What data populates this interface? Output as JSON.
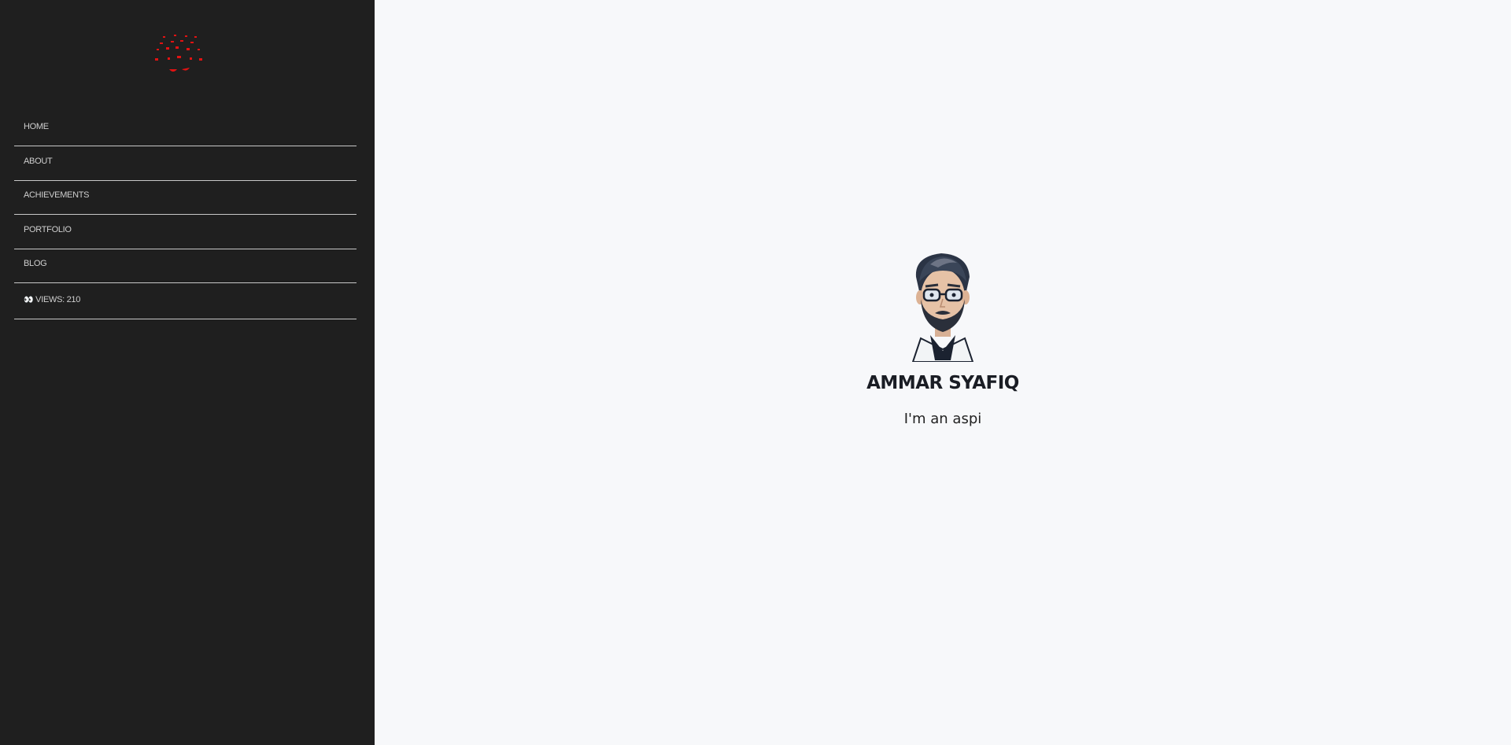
{
  "sidebar": {
    "logo_icon": "red-glyph-logo-icon",
    "accent_color": "#e21212",
    "nav": [
      {
        "label": "HOME"
      },
      {
        "label": "ABOUT"
      },
      {
        "label": "ACHIEVEMENTS"
      },
      {
        "label": "PORTFOLIO"
      },
      {
        "label": "BLOG"
      }
    ],
    "views": {
      "icon": "👀",
      "label": "VIEWS: 210"
    }
  },
  "main": {
    "avatar_icon": "bearded-man-glasses-avatar",
    "name": "AMMAR SYAFIQ",
    "tagline": "I'm an aspi"
  }
}
